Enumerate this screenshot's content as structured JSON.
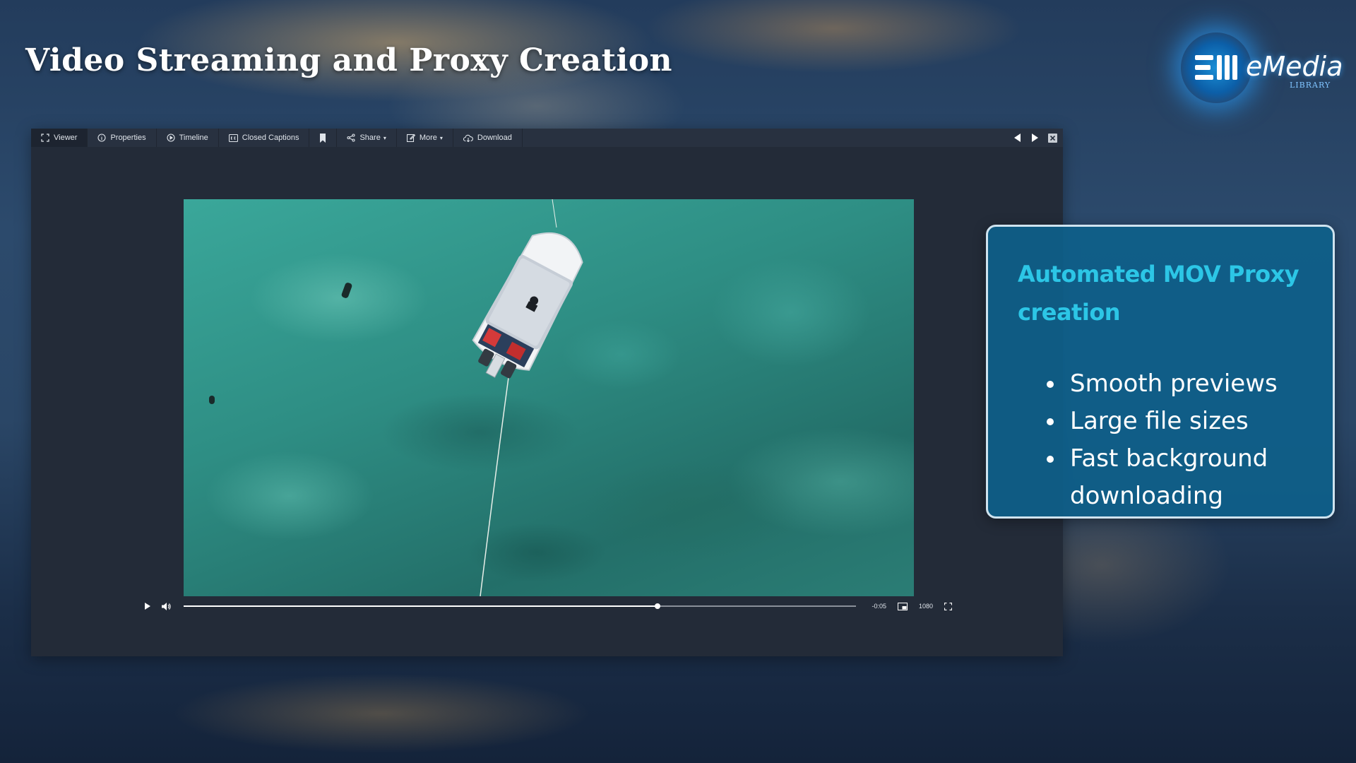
{
  "slide": {
    "title": "Video Streaming and Proxy Creation"
  },
  "logo": {
    "name": "eMedia",
    "sub": "LIBRARY"
  },
  "toolbar": {
    "tabs": [
      {
        "label": "Viewer",
        "icon": "fullscreen-icon"
      },
      {
        "label": "Properties",
        "icon": "info-icon"
      },
      {
        "label": "Timeline",
        "icon": "play-circle-icon"
      },
      {
        "label": "Closed Captions",
        "icon": "cc-icon"
      },
      {
        "label": "",
        "icon": "bookmark-icon"
      },
      {
        "label": "Share",
        "icon": "share-icon"
      },
      {
        "label": "More",
        "icon": "edit-icon"
      },
      {
        "label": "Download",
        "icon": "cloud-download-icon"
      }
    ],
    "nav": [
      "previous-arrow-icon",
      "next-arrow-icon",
      "close-icon"
    ]
  },
  "player": {
    "time_remaining": "-0:05",
    "quality": "1080",
    "progress": 0.705
  },
  "panel": {
    "heading": "Automated MOV Proxy creation",
    "bullets": [
      "Smooth previews",
      "Large file sizes",
      "Fast background downloading"
    ]
  },
  "colors": {
    "panel_bg": "#0e608a",
    "panel_heading": "#2cc6e6",
    "panel_border": "#cfe3ef",
    "viewer_bg": "#232b38"
  }
}
